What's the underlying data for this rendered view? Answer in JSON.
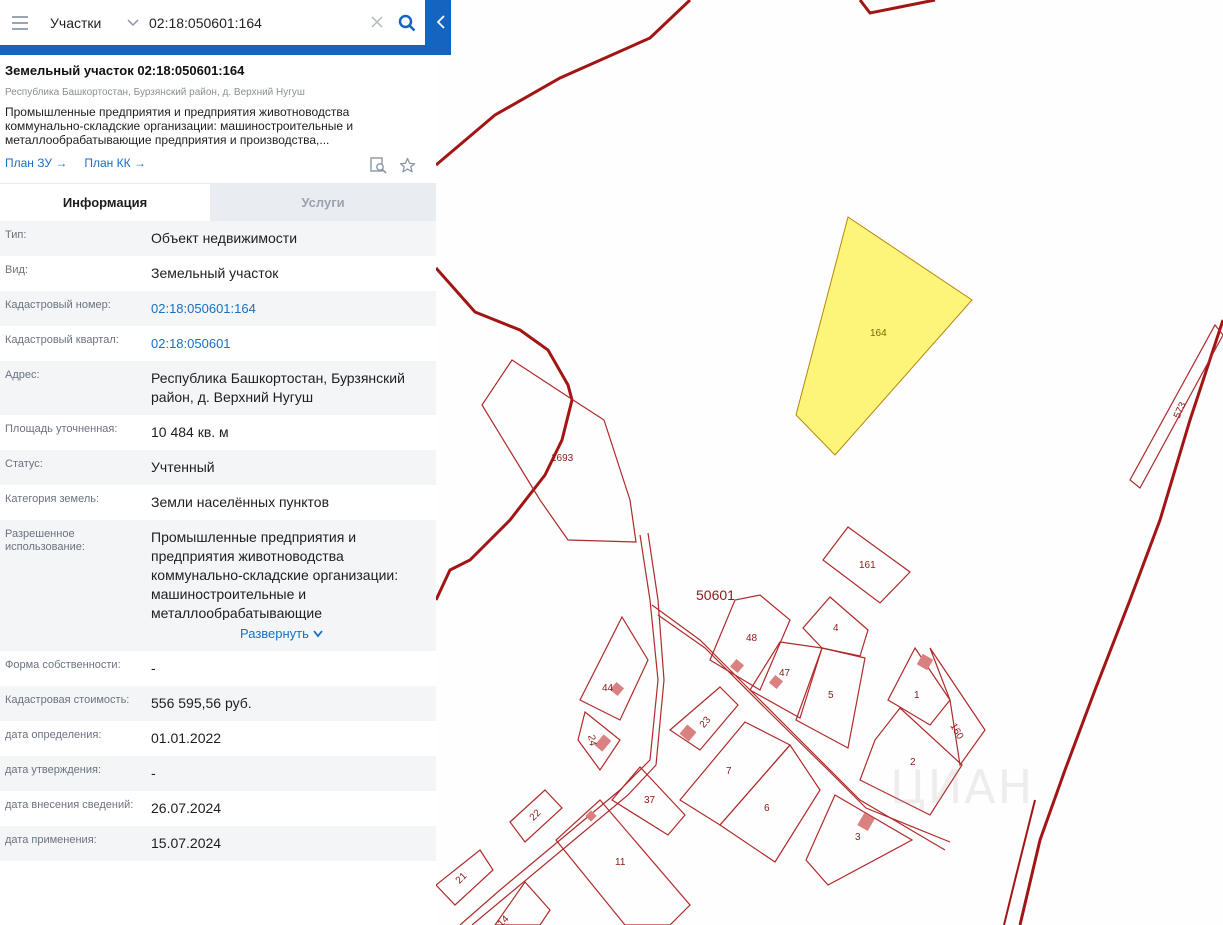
{
  "search": {
    "type_label": "Участки",
    "value": "02:18:050601:164"
  },
  "header": {
    "title": "Земельный участок 02:18:050601:164",
    "address": "Республика Башкортостан, Бурзянский район, д. Верхний Нугуш",
    "usage_short": "Промышленные предприятия и предприятия животноводства коммунально-складские организации: машиностроительные и металлообрабатывающие предприятия и производства,...",
    "link_plan_zu": "План ЗУ →",
    "link_plan_kk": "План КК →"
  },
  "tabs": {
    "info": "Информация",
    "services": "Услуги"
  },
  "info_rows": [
    {
      "key": "Тип:",
      "value": "Объект недвижимости"
    },
    {
      "key": "Вид:",
      "value": "Земельный участок"
    },
    {
      "key": "Кадастровый номер:",
      "value": "02:18:050601:164"
    },
    {
      "key": "Кадастровый квартал:",
      "value": "02:18:050601"
    },
    {
      "key": "Адрес:",
      "value": "Республика Башкортостан, Бурзянский район, д. Верхний Нугуш"
    },
    {
      "key": "Площадь уточненная:",
      "value": "10 484 кв. м"
    },
    {
      "key": "Статус:",
      "value": "Учтенный"
    },
    {
      "key": "Категория земель:",
      "value": "Земли населённых пунктов"
    },
    {
      "key": "Разрешенное использование:",
      "value": "Промышленные предприятия и предприятия животноводства коммунально-складские организации: машиностроительные и металлообрабатывающие"
    },
    {
      "key": "Форма собственности:",
      "value": "-"
    },
    {
      "key": "Кадастровая стоимость:",
      "value": "556 595,56 руб."
    },
    {
      "key": "дата определения:",
      "value": "01.01.2022"
    },
    {
      "key": "дата утверждения:",
      "value": "-"
    },
    {
      "key": "дата внесения сведений:",
      "value": "26.07.2024"
    },
    {
      "key": "дата применения:",
      "value": "15.07.2024"
    }
  ],
  "expand_label": "Развернуть",
  "map": {
    "quarter_label": "50601",
    "watermark": "ЦИАН",
    "parcel_labels": [
      "164",
      "1693",
      "161",
      "48",
      "4",
      "47",
      "5",
      "1",
      "160",
      "2",
      "44",
      "23",
      "24",
      "7",
      "6",
      "37",
      "22",
      "3",
      "11",
      "21",
      "14",
      "573"
    ],
    "colors": {
      "selected_fill": "#fdf57a",
      "boundary": "#a31515",
      "parcel": "#b02a2a",
      "building": "#d98080"
    }
  }
}
